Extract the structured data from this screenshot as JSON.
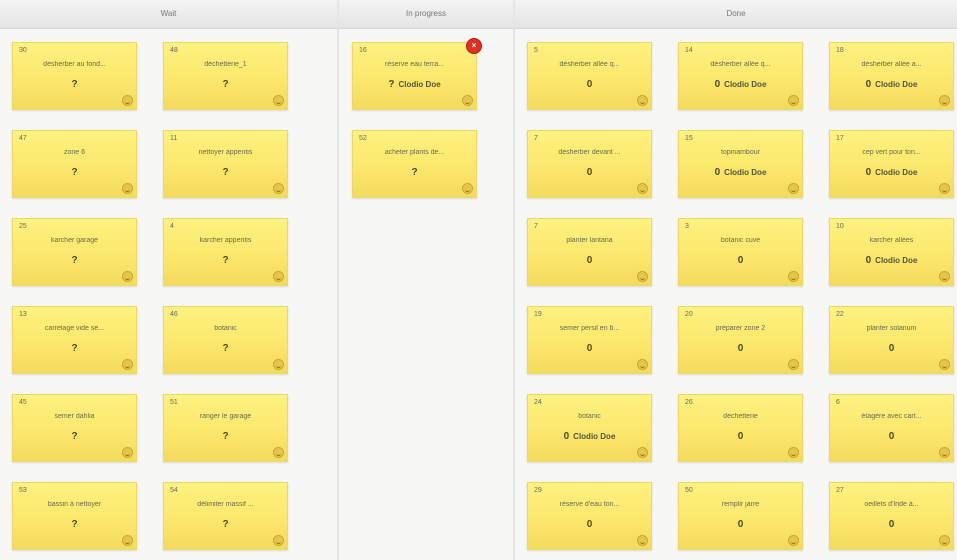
{
  "columns": [
    {
      "id": "wait",
      "title": "Wait"
    },
    {
      "id": "progress",
      "title": "In progress"
    },
    {
      "id": "done",
      "title": "Done"
    }
  ],
  "cards": {
    "wait": [
      {
        "num": "30",
        "title": "désherber au fond...",
        "value": "?",
        "assignee": ""
      },
      {
        "num": "48",
        "title": "déchetterie_1",
        "value": "?",
        "assignee": ""
      },
      {
        "num": "47",
        "title": "zone 6",
        "value": "?",
        "assignee": ""
      },
      {
        "num": "11",
        "title": "nettoyer appentis",
        "value": "?",
        "assignee": ""
      },
      {
        "num": "25",
        "title": "karcher garage",
        "value": "?",
        "assignee": ""
      },
      {
        "num": "4",
        "title": "karcher appentis",
        "value": "?",
        "assignee": ""
      },
      {
        "num": "13",
        "title": "carrelage vide se...",
        "value": "?",
        "assignee": ""
      },
      {
        "num": "46",
        "title": "botanic",
        "value": "?",
        "assignee": ""
      },
      {
        "num": "45",
        "title": "semer dahlia",
        "value": "?",
        "assignee": ""
      },
      {
        "num": "51",
        "title": "ranger le garage",
        "value": "?",
        "assignee": ""
      },
      {
        "num": "53",
        "title": "bassin à nettoyer",
        "value": "?",
        "assignee": ""
      },
      {
        "num": "54",
        "title": "délimiter massif ...",
        "value": "?",
        "assignee": ""
      }
    ],
    "progress": [
      {
        "num": "16",
        "title": "réserve eau terra...",
        "value": "?",
        "assignee": "Clodio Doe",
        "blocked": "×"
      },
      {
        "num": "52",
        "title": "acheter plants de...",
        "value": "?",
        "assignee": ""
      }
    ],
    "done": [
      {
        "num": "5",
        "title": "désherber allée q...",
        "value": "0",
        "assignee": ""
      },
      {
        "num": "14",
        "title": "désherber allée q...",
        "value": "0",
        "assignee": "Clodio Doe"
      },
      {
        "num": "18",
        "title": "désherber allée a...",
        "value": "0",
        "assignee": "Clodio Doe"
      },
      {
        "num": "7",
        "title": "désherber devant ...",
        "value": "0",
        "assignee": ""
      },
      {
        "num": "15",
        "title": "topinambour",
        "value": "0",
        "assignee": "Clodio Doe"
      },
      {
        "num": "17",
        "title": "cep vert pour ton...",
        "value": "0",
        "assignee": "Clodio Doe"
      },
      {
        "num": "7",
        "title": "planter lantana",
        "value": "0",
        "assignee": ""
      },
      {
        "num": "3",
        "title": "botanic cuve",
        "value": "0",
        "assignee": ""
      },
      {
        "num": "10",
        "title": "karcher allées",
        "value": "0",
        "assignee": "Clodio Doe"
      },
      {
        "num": "19",
        "title": "semer persil en b...",
        "value": "0",
        "assignee": ""
      },
      {
        "num": "20",
        "title": "préparer zone 2",
        "value": "0",
        "assignee": ""
      },
      {
        "num": "22",
        "title": "planter solanum",
        "value": "0",
        "assignee": ""
      },
      {
        "num": "24",
        "title": "botanic",
        "value": "0",
        "assignee": "Clodio Doe"
      },
      {
        "num": "26",
        "title": "déchetterie",
        "value": "0",
        "assignee": ""
      },
      {
        "num": "6",
        "title": "étagère avec cart...",
        "value": "0",
        "assignee": ""
      },
      {
        "num": "29",
        "title": "réserve d'eau ton...",
        "value": "0",
        "assignee": ""
      },
      {
        "num": "50",
        "title": "remplir jarre",
        "value": "0",
        "assignee": ""
      },
      {
        "num": "27",
        "title": "oeillets d'Inde à...",
        "value": "0",
        "assignee": ""
      }
    ]
  },
  "icons": {
    "card_status": "smiley-icon",
    "blocked": "blocked-badge-icon"
  },
  "colors": {
    "card": "#fbe76d",
    "blocked": "#e03020"
  }
}
